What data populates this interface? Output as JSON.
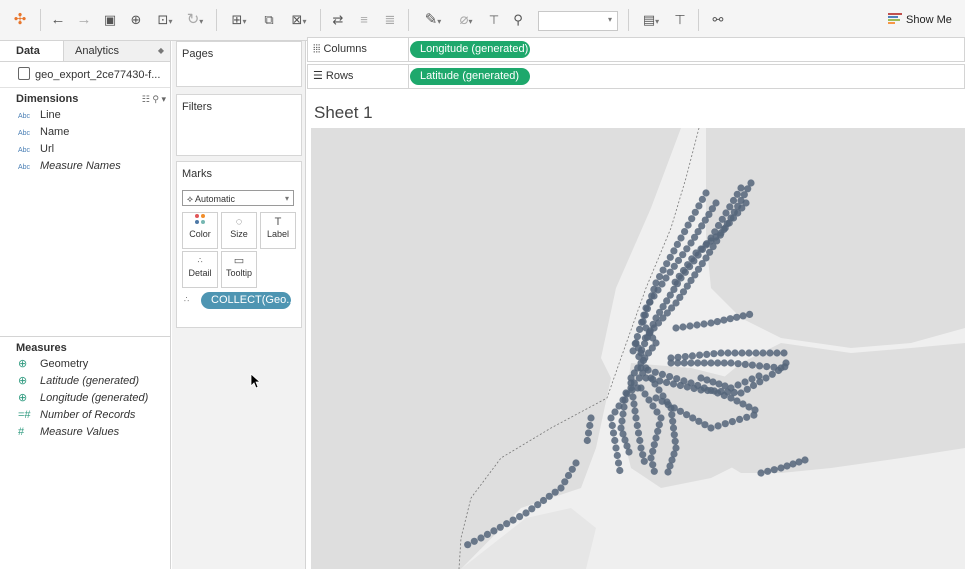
{
  "toolbar": {
    "show_me_label": "Show Me",
    "icons": [
      "tableau-logo-icon",
      "undo-icon",
      "redo-icon",
      "save-icon",
      "new-datasource-icon",
      "pause-updates-icon",
      "refresh-icon",
      "new-worksheet-icon",
      "duplicate-sheet-icon",
      "clear-sheet-icon",
      "swap-axes-icon",
      "sort-ascending-icon",
      "sort-descending-icon",
      "highlight-icon",
      "group-icon",
      "labels-icon",
      "fix-axes-icon",
      "fit-combo",
      "show-cards-icon",
      "presentation-icon",
      "share-icon"
    ]
  },
  "left_pane": {
    "tabs": {
      "data": "Data",
      "analytics": "Analytics"
    },
    "datasource_name": "geo_export_2ce77430-f...",
    "dimensions": {
      "title": "Dimensions",
      "fields": [
        {
          "type": "Abc",
          "name": "Line"
        },
        {
          "type": "Abc",
          "name": "Name"
        },
        {
          "type": "Abc",
          "name": "Url"
        },
        {
          "type": "Abc",
          "name": "Measure Names"
        }
      ]
    },
    "measures": {
      "title": "Measures",
      "fields": [
        {
          "type": "geo",
          "name": "Geometry"
        },
        {
          "type": "geo",
          "name": "Latitude (generated)"
        },
        {
          "type": "geo",
          "name": "Longitude (generated)"
        },
        {
          "type": "num",
          "name": "Number of Records"
        },
        {
          "type": "num",
          "name": "Measure Values"
        }
      ]
    }
  },
  "shelves": {
    "pages_title": "Pages",
    "filters_title": "Filters",
    "marks": {
      "title": "Marks",
      "type_value": "Automatic",
      "buttons": {
        "color": "Color",
        "size": "Size",
        "label": "Label",
        "detail": "Detail",
        "tooltip": "Tooltip"
      },
      "pill": "COLLECT(Geo.."
    },
    "columns": {
      "label": "Columns",
      "pill": "Longitude (generated)"
    },
    "rows": {
      "label": "Rows",
      "pill": "Latitude (generated)"
    }
  },
  "view": {
    "sheet_title": "Sheet 1",
    "mark_color": "#55657a",
    "map_land_color": "#dedede",
    "map_water_color": "#efefef"
  },
  "colors": {
    "accent_green": "#1ea86c",
    "accent_blue": "#4e95b2"
  }
}
